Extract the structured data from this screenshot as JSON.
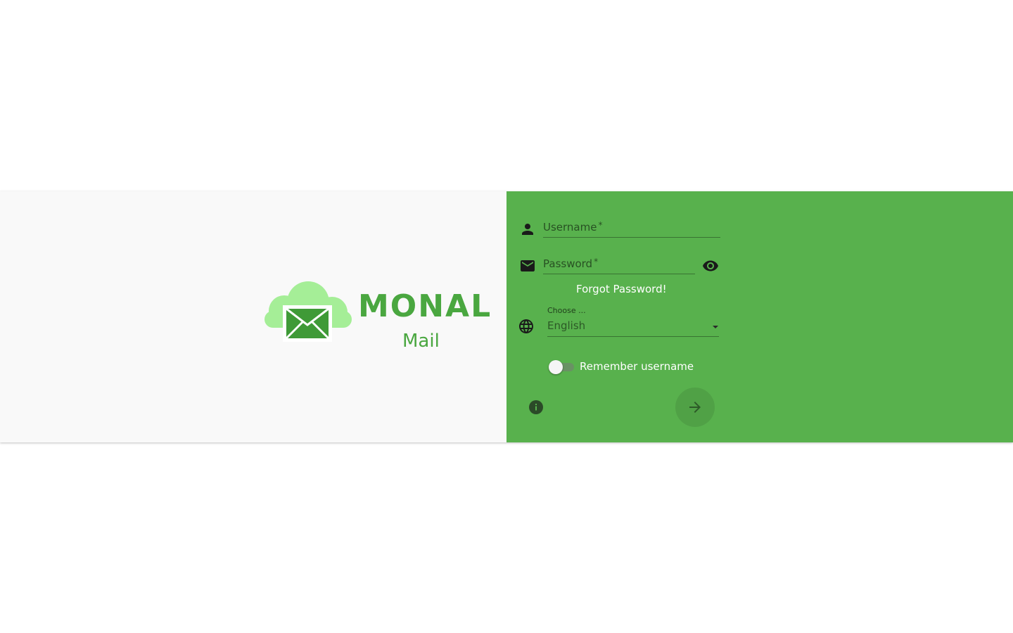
{
  "logo": {
    "brand_name": "MONAL",
    "subtitle": "Mail",
    "colors": {
      "cloud": "#a5ee97",
      "envelope": "#3f9a37",
      "text": "#4aa740",
      "accent": "#f2b200"
    }
  },
  "form": {
    "username": {
      "icon": "person-icon",
      "label": "Username",
      "required_mark": "*",
      "value": ""
    },
    "password": {
      "icon": "mail-icon",
      "label": "Password",
      "required_mark": "*",
      "value": "",
      "visibility_icon": "eye-icon"
    },
    "forgot_password_label": "Forgot Password!",
    "language": {
      "icon": "globe-icon",
      "label": "Choose ...",
      "selected": "English"
    },
    "remember": {
      "label": "Remember username",
      "checked": false
    },
    "info_icon": "info-icon",
    "submit_icon": "arrow-right-icon"
  },
  "theme": {
    "left_panel_bg": "#f9f9f9",
    "right_panel_bg": "#58b14d"
  }
}
